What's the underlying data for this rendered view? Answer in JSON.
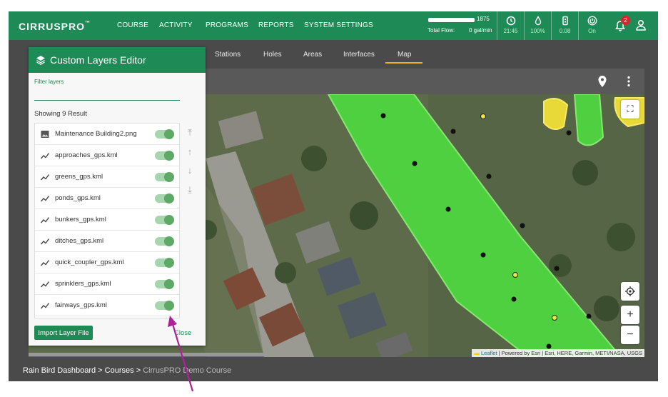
{
  "app": {
    "logo": "CIRRUSPRO",
    "logo_suffix": "™"
  },
  "nav": [
    "COURSE",
    "ACTIVITY",
    "PROGRAMS",
    "REPORTS",
    "SYSTEM SETTINGS"
  ],
  "flow": {
    "total": "1875",
    "label": "Total Flow:",
    "value": "0 gal/min",
    "level": 1.0
  },
  "stats": [
    {
      "icon": "clock-icon",
      "value": "21:45"
    },
    {
      "icon": "water-drop-icon",
      "value": "100%"
    },
    {
      "icon": "gauge-icon",
      "value": "0.08"
    },
    {
      "icon": "power-icon",
      "value": "On"
    }
  ],
  "notifications": {
    "count": "2"
  },
  "tabs": [
    "Stations",
    "Holes",
    "Areas",
    "Interfaces",
    "Map"
  ],
  "active_tab": "Map",
  "panel": {
    "title": "Custom Layers Editor",
    "filter_label": "Filter layers",
    "filter_value": "",
    "showing": "Showing 9 Result",
    "layers": [
      {
        "name": "Maintenance Building2.png",
        "icon": "image-icon",
        "enabled": true
      },
      {
        "name": "approaches_gps.kml",
        "icon": "polyline-icon",
        "enabled": true
      },
      {
        "name": "greens_gps.kml",
        "icon": "polyline-icon",
        "enabled": true
      },
      {
        "name": "ponds_gps.kml",
        "icon": "polyline-icon",
        "enabled": true
      },
      {
        "name": "bunkers_gps.kml",
        "icon": "polyline-icon",
        "enabled": true
      },
      {
        "name": "ditches_gps.kml",
        "icon": "polyline-icon",
        "enabled": true
      },
      {
        "name": "quick_coupler_gps.kml",
        "icon": "polyline-icon",
        "enabled": true
      },
      {
        "name": "sprinklers_gps.kml",
        "icon": "polyline-icon",
        "enabled": true
      },
      {
        "name": "fairways_gps.kml",
        "icon": "polyline-icon",
        "enabled": true
      }
    ],
    "import_label": "Import Layer File",
    "close_label": "Close"
  },
  "map": {
    "zoom_in": "+",
    "zoom_out": "−",
    "attribution_leaflet": "Leaflet",
    "attribution_rest": " | Powered by Esri | Esri, HERE, Garmin, METI/NASA, USGS"
  },
  "breadcrumb": {
    "items": [
      "Rain Bird Dashboard",
      "Courses"
    ],
    "separator": " > ",
    "current": "CirrusPRO Demo Course"
  },
  "colors": {
    "brand_green": "#1e8a55",
    "active_tab": "#f0b020",
    "fairway": "#4fd040",
    "bunker": "#e8d838",
    "toggle_on": "#5ea966"
  }
}
